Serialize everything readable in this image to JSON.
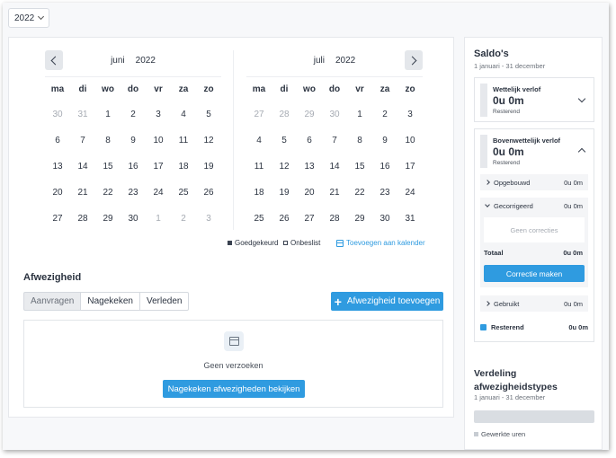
{
  "year_select": {
    "value": "2022"
  },
  "calendars": [
    {
      "month": "juni",
      "year": "2022",
      "weekdays": [
        "ma",
        "di",
        "wo",
        "do",
        "vr",
        "za",
        "zo"
      ],
      "days": [
        {
          "d": "30",
          "m": true
        },
        {
          "d": "31",
          "m": true
        },
        {
          "d": "1"
        },
        {
          "d": "2"
        },
        {
          "d": "3"
        },
        {
          "d": "4"
        },
        {
          "d": "5"
        },
        {
          "d": "6"
        },
        {
          "d": "7"
        },
        {
          "d": "8"
        },
        {
          "d": "9"
        },
        {
          "d": "10"
        },
        {
          "d": "11"
        },
        {
          "d": "12"
        },
        {
          "d": "13"
        },
        {
          "d": "14"
        },
        {
          "d": "15"
        },
        {
          "d": "16"
        },
        {
          "d": "17"
        },
        {
          "d": "18"
        },
        {
          "d": "19"
        },
        {
          "d": "20"
        },
        {
          "d": "21"
        },
        {
          "d": "22"
        },
        {
          "d": "23"
        },
        {
          "d": "24"
        },
        {
          "d": "25"
        },
        {
          "d": "26"
        },
        {
          "d": "27"
        },
        {
          "d": "28"
        },
        {
          "d": "29"
        },
        {
          "d": "30"
        },
        {
          "d": "1",
          "m": true
        },
        {
          "d": "2",
          "m": true
        },
        {
          "d": "3",
          "m": true
        }
      ]
    },
    {
      "month": "juli",
      "year": "2022",
      "weekdays": [
        "ma",
        "di",
        "wo",
        "do",
        "vr",
        "za",
        "zo"
      ],
      "days": [
        {
          "d": "27",
          "m": true
        },
        {
          "d": "28",
          "m": true
        },
        {
          "d": "29",
          "m": true
        },
        {
          "d": "30",
          "m": true
        },
        {
          "d": "1"
        },
        {
          "d": "2"
        },
        {
          "d": "3"
        },
        {
          "d": "4"
        },
        {
          "d": "5"
        },
        {
          "d": "6"
        },
        {
          "d": "7"
        },
        {
          "d": "8"
        },
        {
          "d": "9"
        },
        {
          "d": "10"
        },
        {
          "d": "11"
        },
        {
          "d": "12"
        },
        {
          "d": "13"
        },
        {
          "d": "14"
        },
        {
          "d": "15"
        },
        {
          "d": "16"
        },
        {
          "d": "17"
        },
        {
          "d": "18"
        },
        {
          "d": "19"
        },
        {
          "d": "20"
        },
        {
          "d": "21"
        },
        {
          "d": "22"
        },
        {
          "d": "23"
        },
        {
          "d": "24"
        },
        {
          "d": "25"
        },
        {
          "d": "26"
        },
        {
          "d": "27"
        },
        {
          "d": "28"
        },
        {
          "d": "29"
        },
        {
          "d": "30"
        },
        {
          "d": "31"
        }
      ]
    }
  ],
  "legend": {
    "approved": "Goedgekeurd",
    "unreviewed": "Onbeslist",
    "add_to_calendar": "Toevoegen aan kalender"
  },
  "absence": {
    "title": "Afwezigheid",
    "tabs": [
      "Aanvragen",
      "Nagekeken",
      "Verleden"
    ],
    "add_button": "Afwezigheid toevoegen",
    "empty_text": "Geen verzoeken",
    "view_button": "Nagekeken afwezigheden bekijken"
  },
  "saldo": {
    "title": "Saldo's",
    "period": "1 januari - 31 december",
    "legal": {
      "label": "Wettelijk verlof",
      "value": "0u 0m",
      "sub": "Resterend"
    },
    "extra": {
      "label": "Bovenwettelijk verlof",
      "value": "0u 0m",
      "sub": "Resterend",
      "accrued": {
        "label": "Opgebouwd",
        "value": "0u 0m"
      },
      "corrected": {
        "label": "Gecorrigeerd",
        "value": "0u 0m"
      },
      "no_corrections": "Geen correcties",
      "total_label": "Totaal",
      "total_value": "0u 0m",
      "correction_button": "Correctie maken",
      "used": {
        "label": "Gebruikt",
        "value": "0u 0m"
      },
      "remaining": {
        "label": "Resterend",
        "value": "0u 0m"
      }
    }
  },
  "distribution": {
    "title": "Verdeling afwezigheidstypes",
    "period": "1 januari - 31 december",
    "legend": "Gewerkte uren"
  },
  "colors": {
    "accent": "#2f9be0",
    "text": "#2b3340",
    "muted": "#a6abb3"
  }
}
